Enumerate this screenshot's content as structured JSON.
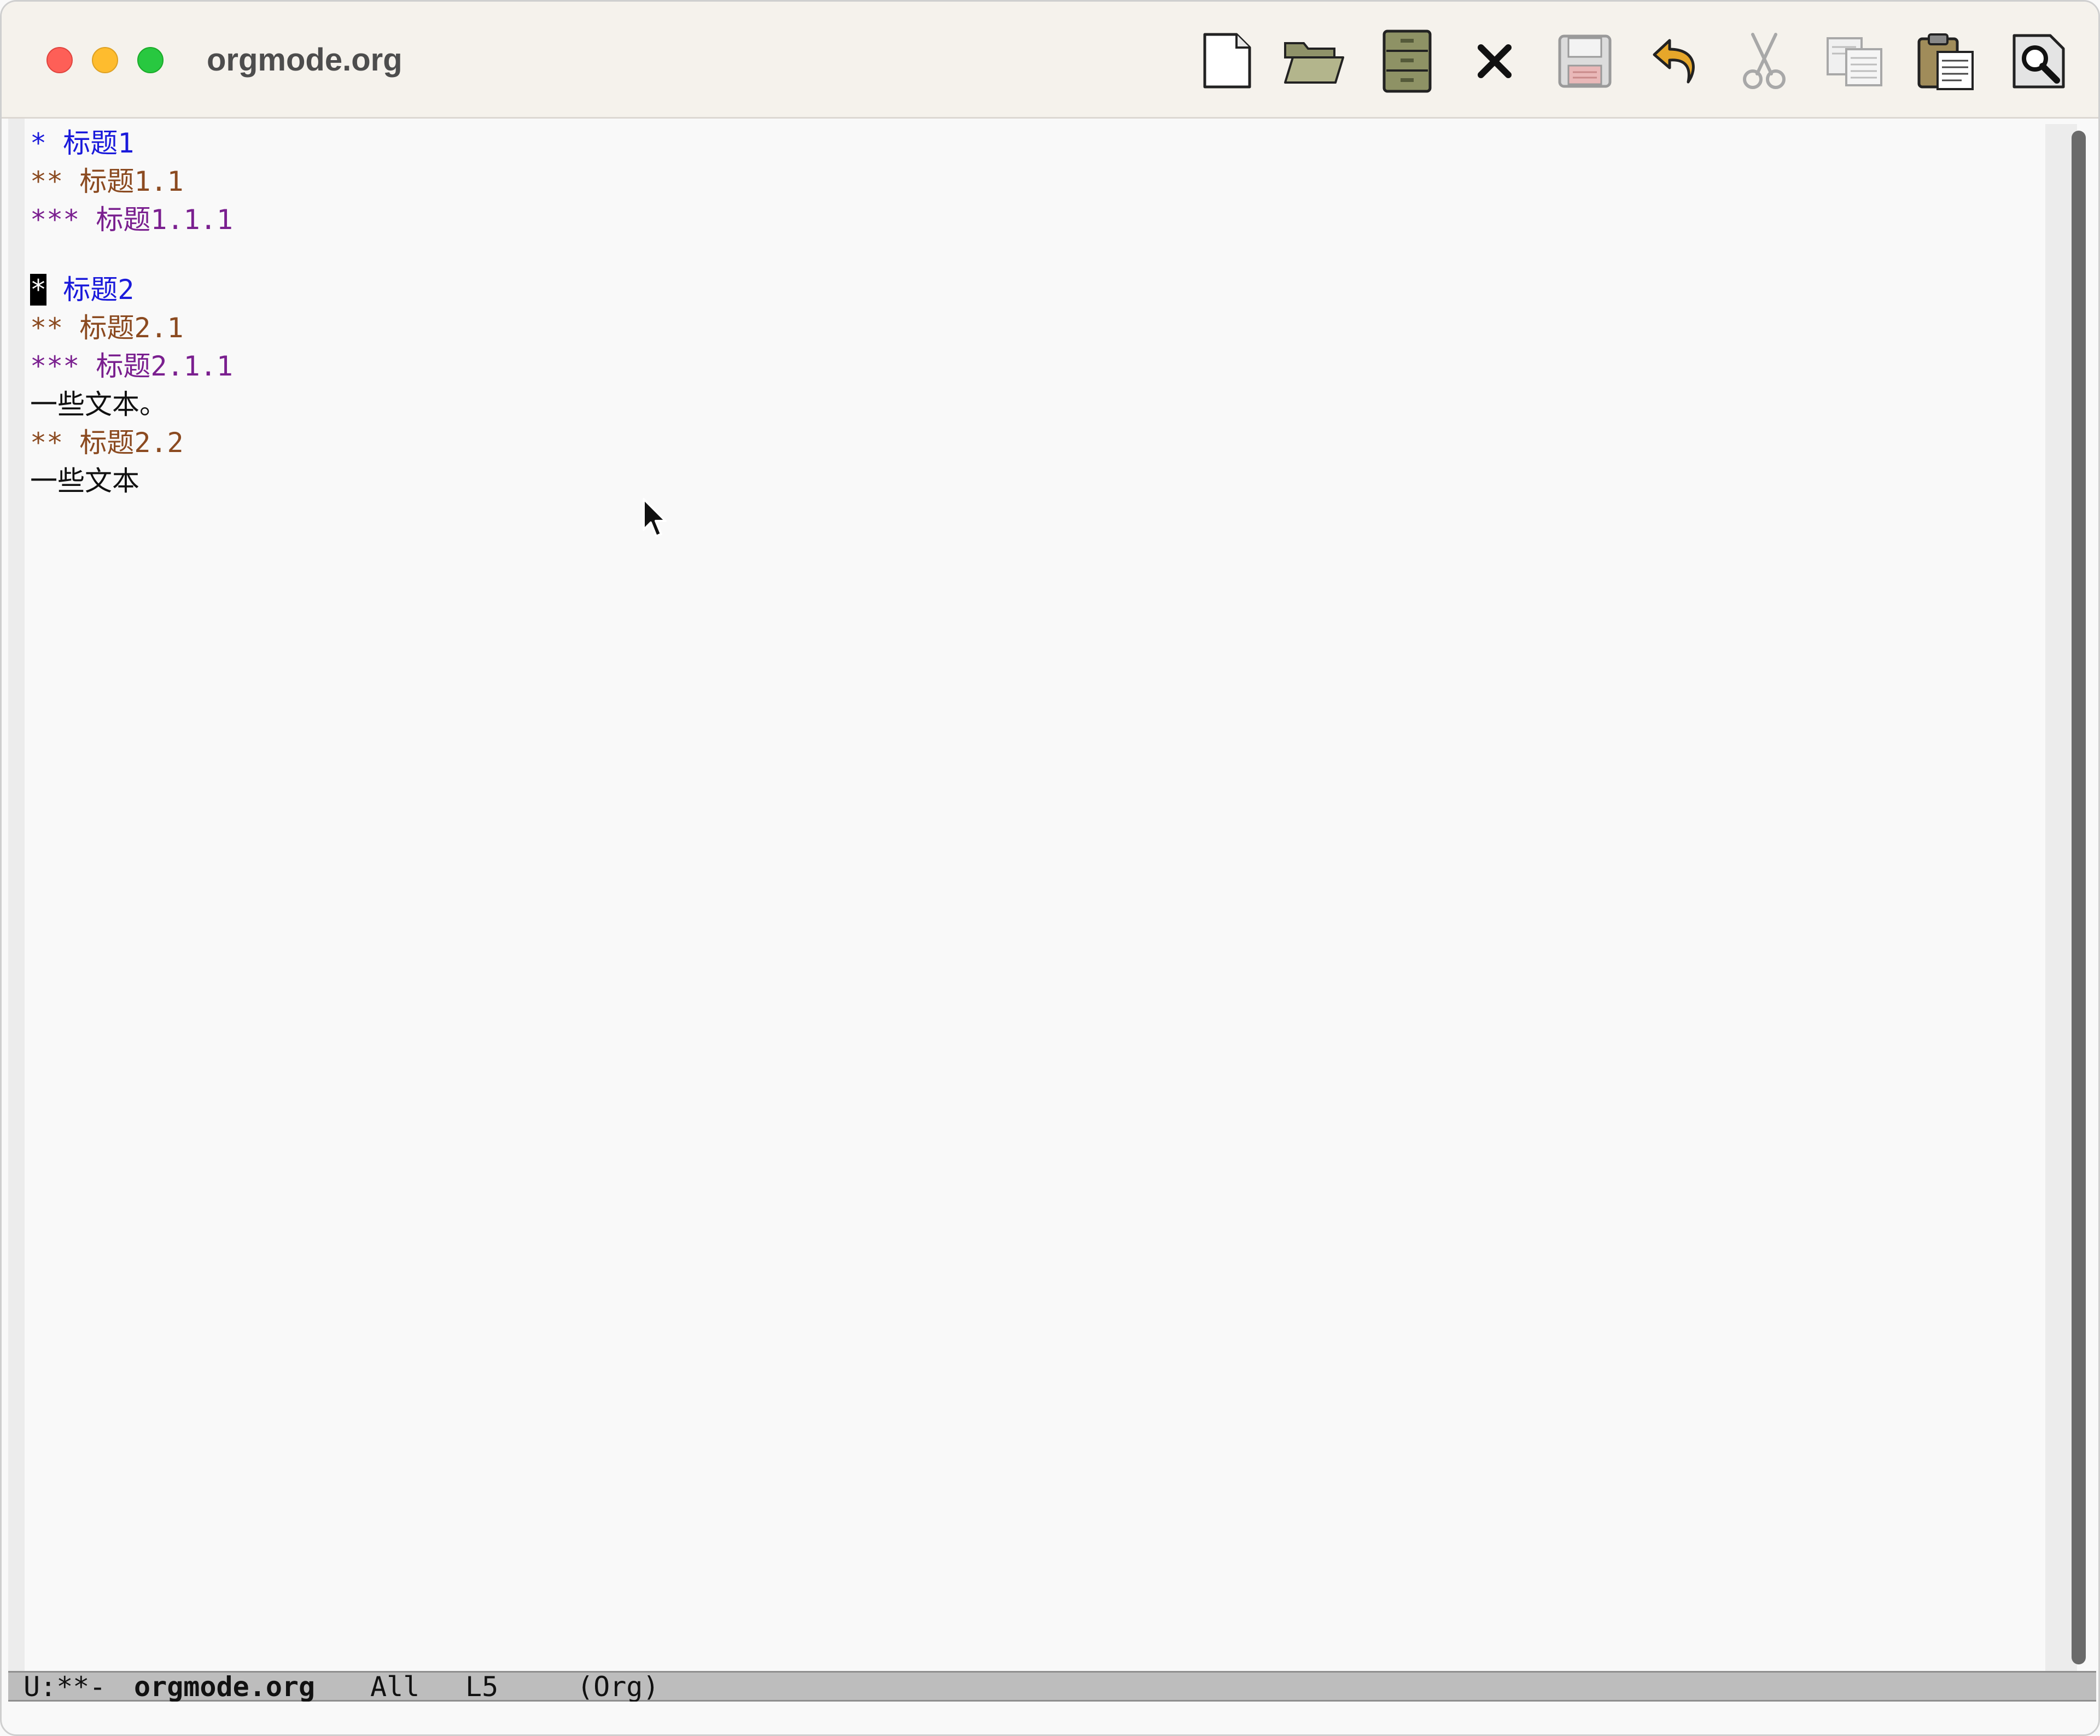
{
  "window": {
    "title": "orgmode.org"
  },
  "toolbar": {
    "buttons": [
      {
        "name": "new-file",
        "icon": "new-file-icon"
      },
      {
        "name": "open-folder",
        "icon": "open-folder-icon"
      },
      {
        "name": "dired",
        "icon": "file-cabinet-icon"
      },
      {
        "name": "kill-buffer",
        "icon": "close-x-icon"
      },
      {
        "name": "save",
        "icon": "floppy-disk-icon"
      },
      {
        "name": "undo",
        "icon": "undo-arrow-icon"
      },
      {
        "name": "cut",
        "icon": "scissors-icon"
      },
      {
        "name": "copy",
        "icon": "copy-icon"
      },
      {
        "name": "paste",
        "icon": "clipboard-icon"
      },
      {
        "name": "search",
        "icon": "magnifier-icon"
      }
    ]
  },
  "buffer": {
    "lines": [
      {
        "stars": "*",
        "rest": " 标题1",
        "level": 1
      },
      {
        "stars": "**",
        "rest": " 标题1.1",
        "level": 2
      },
      {
        "stars": "***",
        "rest": " 标题1.1.1",
        "level": 3
      },
      {
        "stars": "",
        "rest": "",
        "level": 0
      },
      {
        "stars": "*",
        "rest": " 标题2",
        "level": 1,
        "cursor": true
      },
      {
        "stars": "**",
        "rest": " 标题2.1",
        "level": 2
      },
      {
        "stars": "***",
        "rest": " 标题2.1.1",
        "level": 3
      },
      {
        "stars": "",
        "rest": "一些文本。",
        "level": 0
      },
      {
        "stars": "**",
        "rest": " 标题2.2",
        "level": 2
      },
      {
        "stars": "",
        "rest": "一些文本",
        "level": 0
      }
    ],
    "line1_stars": "*",
    "line1_text": " 标题1",
    "line2_stars": "**",
    "line2_text": " 标题1.1",
    "line3_stars": "***",
    "line3_text": " 标题1.1.1",
    "line5_stars": "*",
    "line5_text": " 标题2",
    "line6_stars": "**",
    "line6_text": " 标题2.1",
    "line7_stars": "***",
    "line7_text": " 标题2.1.1",
    "line8_text": "一些文本。",
    "line9_stars": "**",
    "line9_text": " 标题2.2",
    "line10_text": "一些文本"
  },
  "modeline": {
    "status": "U:**-",
    "buffer_name": "orgmode.org",
    "position": "All",
    "line": "L5",
    "mode": "(Org)"
  },
  "colors": {
    "heading1": "#1a1adb",
    "heading2": "#8b4a20",
    "heading3": "#7a1f8f",
    "modeline_bg": "#bdbdbd"
  }
}
